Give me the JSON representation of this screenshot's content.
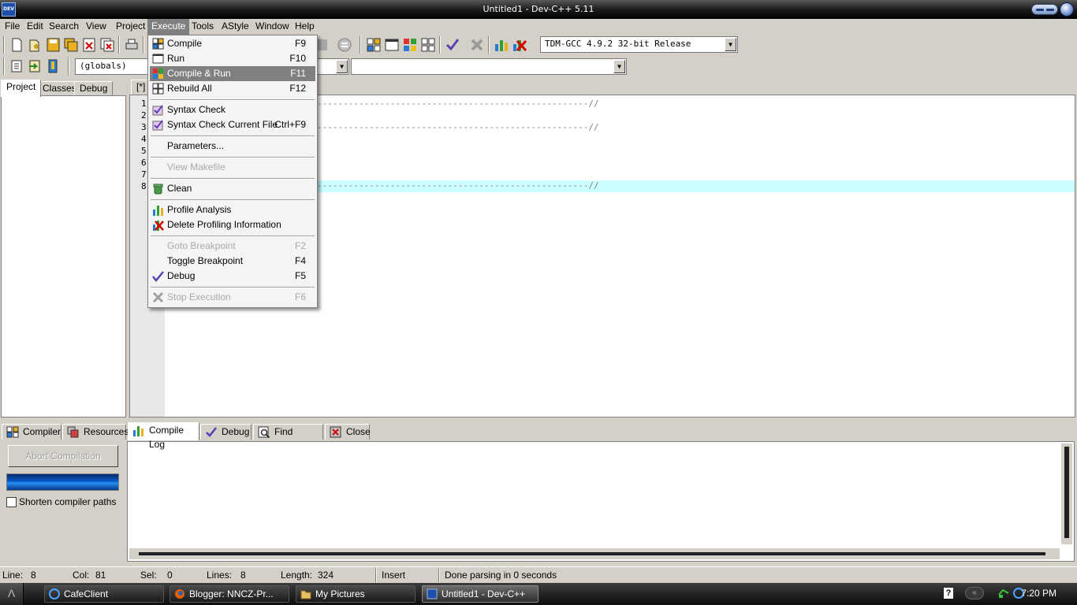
{
  "window": {
    "title": "Untitled1 - Dev-C++ 5.11",
    "app_icon": "DEV"
  },
  "menubar": {
    "items": [
      {
        "label": "File"
      },
      {
        "label": "Edit"
      },
      {
        "label": "Search"
      },
      {
        "label": "View"
      },
      {
        "label": "Project"
      },
      {
        "label": "Execute"
      },
      {
        "label": "Tools"
      },
      {
        "label": "AStyle"
      },
      {
        "label": "Window"
      },
      {
        "label": "Help"
      }
    ],
    "active": "Execute"
  },
  "toolbar": {
    "compiler_select": "TDM-GCC 4.9.2 32-bit Release",
    "scope_select": "(globals)",
    "function_select": ""
  },
  "left_panel": {
    "tabs": [
      "Project",
      "Classes",
      "Debug"
    ],
    "active_tab": "Project"
  },
  "editor": {
    "tab_label": "[*] U",
    "lines": [
      {
        "n": "1",
        "text": "----------------------------------------------------//"
      },
      {
        "n": "2",
        "text": ""
      },
      {
        "n": "3",
        "text": "----------------------------------------------------//"
      },
      {
        "n": "4",
        "text": ""
      },
      {
        "n": "5",
        "text": ""
      },
      {
        "n": "6",
        "text": ""
      },
      {
        "n": "7",
        "text": ""
      },
      {
        "n": "8",
        "text": "----------------------------------------------------//"
      }
    ],
    "current_line": 8
  },
  "execute_menu": {
    "items": [
      {
        "label": "Compile",
        "key": "F9",
        "icon": "compile-icon"
      },
      {
        "label": "Run",
        "key": "F10",
        "icon": "run-icon"
      },
      {
        "label": "Compile & Run",
        "key": "F11",
        "icon": "compile-run-icon",
        "highlighted": true
      },
      {
        "label": "Rebuild All",
        "key": "F12",
        "icon": "rebuild-icon"
      },
      {
        "label": "Syntax Check",
        "key": "",
        "icon": "syntax-check-icon"
      },
      {
        "label": "Syntax Check Current File",
        "key": "Ctrl+F9",
        "icon": "syntax-check-file-icon"
      },
      {
        "label": "Parameters...",
        "key": ""
      },
      {
        "label": "View Makefile",
        "key": "",
        "disabled": true
      },
      {
        "label": "Clean",
        "key": "",
        "icon": "clean-icon"
      },
      {
        "label": "Profile Analysis",
        "key": "",
        "icon": "profile-icon"
      },
      {
        "label": "Delete Profiling Information",
        "key": "",
        "icon": "delete-profile-icon"
      },
      {
        "label": "Goto Breakpoint",
        "key": "F2",
        "disabled": true
      },
      {
        "label": "Toggle Breakpoint",
        "key": "F4"
      },
      {
        "label": "Debug",
        "key": "F5",
        "icon": "debug-check-icon"
      },
      {
        "label": "Stop Execution",
        "key": "F6",
        "icon": "stop-icon",
        "disabled": true
      }
    ]
  },
  "bottom_panel": {
    "tabs": [
      {
        "label": "Compiler",
        "icon": "compiler-icon"
      },
      {
        "label": "Resources",
        "icon": "resources-icon"
      },
      {
        "label": "Compile Log",
        "icon": "compile-log-icon",
        "active": true
      },
      {
        "label": "Debug",
        "icon": "debug-icon"
      },
      {
        "label": "Find Results",
        "icon": "find-icon"
      },
      {
        "label": "Close",
        "icon": "close-icon"
      }
    ],
    "abort_button": "Abort Compilation",
    "shorten_paths_label": "Shorten compiler paths",
    "shorten_paths_checked": false
  },
  "statusbar": {
    "line_label": "Line:",
    "line_value": "8",
    "col_label": "Col:",
    "col_value": "81",
    "sel_label": "Sel:",
    "sel_value": "0",
    "lines_label": "Lines:",
    "lines_value": "8",
    "length_label": "Length:",
    "length_value": "324",
    "mode": "Insert",
    "message": "Done parsing in 0 seconds"
  },
  "taskbar": {
    "tasks": [
      {
        "label": "CafeClient",
        "icon": "cafeclient-icon"
      },
      {
        "label": "Blogger: NNCZ-Pr...",
        "icon": "firefox-icon"
      },
      {
        "label": "My Pictures",
        "icon": "folder-icon"
      },
      {
        "label": "Untitled1 - Dev-C++",
        "icon": "devcpp-icon",
        "active": true
      }
    ],
    "time": "7:20 PM",
    "help_glyph": "?",
    "start_glyph": "Λ"
  }
}
